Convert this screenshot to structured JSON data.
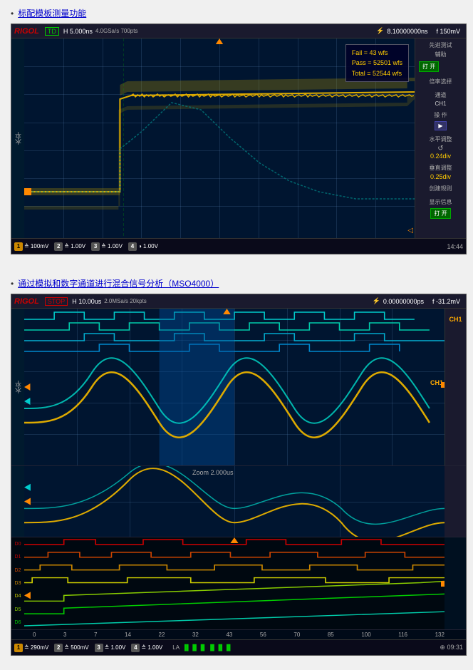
{
  "section1": {
    "bullet": "•",
    "link_text": "标配模板测量功能"
  },
  "scope1": {
    "logo": "RIGOL",
    "status": "TD",
    "timebase": "H  5.000ns",
    "acq": "4.0GSa/s\n700 pts",
    "trigger_time": "8.10000000ns",
    "trigger_icon": "T",
    "trigger_volt": "f  150mV",
    "ylabel": "水平",
    "stats": {
      "fail": "Fail = 43 wfs",
      "pass": "Pass = 52501 wfs",
      "total": "Total = 52544 wfs"
    },
    "rightpanel": {
      "adv_test_label": "先进测试",
      "adv_test_help": "辅助",
      "open_label": "打 开",
      "select_label": "倍率选择",
      "ch_label": "通道",
      "ch_val": "CH1",
      "operate_label": "操 作",
      "play_btn": "▶",
      "h_adj_label": "水平调整",
      "h_adj_icon": "↺",
      "h_adj_val": "0.24div",
      "v_adj_label": "垂直调整",
      "v_adj_val": "0.25div",
      "create_rule_label": "创建规则",
      "show_info_label": "显示信息",
      "open2_label": "打 开"
    },
    "bottom": {
      "ch1": "1",
      "ch1_val": "≙ 100mV",
      "ch2": "2",
      "ch2_val": "≙ 1.00V",
      "ch3": "3",
      "ch3_val": "≙ 1.00V",
      "ch4": "4",
      "ch4_val": "◑ 1.00V",
      "time": "14:44"
    }
  },
  "section2": {
    "bullet": "•",
    "link_text": "通过模拟和数字通道进行混合信号分析（MSO4000）"
  },
  "scope2": {
    "logo": "RIGOL",
    "status": "STOP",
    "timebase": "H  10.00us",
    "acq": "2.0MSa/s\n20k pts",
    "trigger_time": "0.00000000ps",
    "trigger_icon": "T",
    "trigger_volt": "f  -31.2mV",
    "ylabel": "水平",
    "ch1_label": "CH1",
    "zoom_label": "Zoom 2.000us",
    "timescale_values": [
      "0",
      "3",
      "7",
      "14",
      "22",
      "32",
      "43",
      "56",
      "70",
      "85",
      "100",
      "116",
      "132"
    ],
    "bottom": {
      "ch1": "1",
      "ch1_val": "≙ 290mV",
      "ch2": "2",
      "ch2_val": "≙ 500mV",
      "ch3": "3",
      "ch3_val": "≙ 1.00V",
      "ch4": "4",
      "ch4_val": "≙ 1.00V",
      "la_label": "LA",
      "usb_icon": "⊕",
      "time": "09:31"
    }
  }
}
